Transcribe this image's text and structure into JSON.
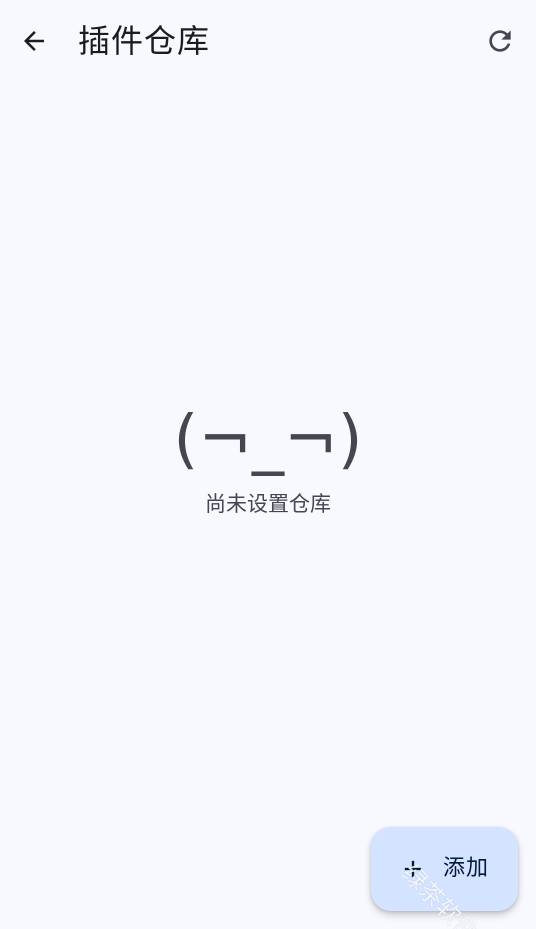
{
  "app_bar": {
    "title": "插件仓库",
    "back_icon": "arrow-back-icon",
    "refresh_icon": "refresh-icon"
  },
  "empty_state": {
    "emoticon": "(¬_¬)",
    "message": "尚未设置仓库"
  },
  "fab": {
    "icon": "plus-icon",
    "label": "添加"
  },
  "watermark": {
    "text": "绿茶软件园"
  },
  "colors": {
    "background": "#f8f9ff",
    "fab_background": "#d4e3ff",
    "text_primary": "#1a1c20",
    "text_secondary": "#44474e"
  }
}
